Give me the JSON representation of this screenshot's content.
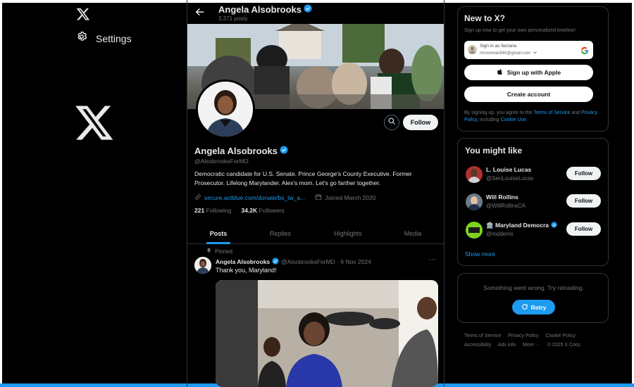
{
  "nav": {
    "settings_label": "Settings",
    "icons": {
      "logo": "x-logo-icon",
      "settings": "gear-icon"
    }
  },
  "profile_header": {
    "name": "Angela Alsobrooks",
    "posts_count": "3,371 posts"
  },
  "profile": {
    "name": "Angela Alsobrooks",
    "handle": "@AlsobrooksForMD",
    "bio": "Democratic candidate for U.S. Senate. Prince George's County Executive. Former Prosecutor. Lifelong Marylander. Alex's mom. Let's go farther together.",
    "link": "secure.actblue.com/donate/bs_tw_a...",
    "joined": "Joined March 2020",
    "following_count": "221",
    "following_label": "Following",
    "followers_count": "34.2K",
    "followers_label": "Followers",
    "follow_label": "Follow"
  },
  "tabs": [
    {
      "label": "Posts",
      "active": true
    },
    {
      "label": "Replies",
      "active": false
    },
    {
      "label": "Highlights",
      "active": false
    },
    {
      "label": "Media",
      "active": false
    }
  ],
  "post": {
    "pinned_label": "Pinned",
    "author": "Angela Alsobrooks",
    "handle_date": "@AlsobrooksForMD · 6 Nov 2024",
    "text": "Thank you, Maryland!",
    "more": "···"
  },
  "new_to_x": {
    "title": "New to X?",
    "subtitle": "Sign up now to get your own personalized timeline!",
    "google_line1": "Sign in as farzana",
    "google_email": "mrsnoman540@gmail.com",
    "apple_label": "Sign up with Apple",
    "create_label": "Create account",
    "legal_prefix": "By signing up, you agree to the ",
    "legal_terms": "Terms of Service",
    "legal_and": " and ",
    "legal_privacy": "Privacy Policy",
    "legal_including": ", including ",
    "legal_cookie": "Cookie Use",
    "legal_end": "."
  },
  "you_might_like": {
    "title": "You might like",
    "items": [
      {
        "name": "L. Louise Lucas",
        "handle": "@SenLouiseLucas",
        "follow": "Follow"
      },
      {
        "name": "Will Rollins",
        "handle": "@WillRollinsCA",
        "follow": "Follow"
      },
      {
        "name": "🏛️ Maryland Democra",
        "handle": "@mddems",
        "follow": "Follow"
      }
    ],
    "show_more": "Show more"
  },
  "error_card": {
    "message": "Something went wrong. Try reloading.",
    "retry_label": "Retry"
  },
  "footer": {
    "links": [
      "Terms of Service",
      "Privacy Policy",
      "Cookie Policy",
      "Accessibility",
      "Ads info",
      "More ···"
    ],
    "copyright": "© 2025 X Corp."
  },
  "colors": {
    "accent": "#1d9bf0",
    "background": "#000000",
    "text": "#e7e9ea",
    "muted": "#71767b",
    "border": "#2f3336"
  }
}
